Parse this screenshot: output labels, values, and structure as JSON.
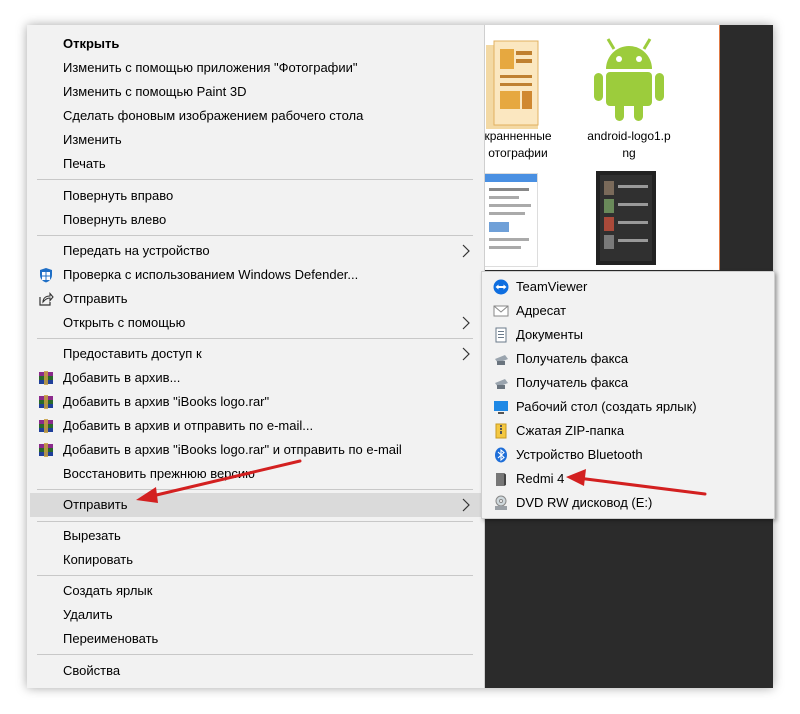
{
  "explorer": {
    "thumbs": [
      {
        "label_line1": "кранненные",
        "label_line2": "отографии",
        "icon": "photos-folder-thumbnail"
      },
      {
        "label_line1": "android-logo1.p",
        "label_line2": "ng",
        "icon": "android-logo-thumbnail"
      }
    ]
  },
  "context_menu": {
    "items": [
      {
        "label": "Открыть",
        "bold": true
      },
      {
        "label": "Изменить с помощью приложения \"Фотографии\""
      },
      {
        "label": "Изменить с помощью Paint 3D"
      },
      {
        "label": "Сделать фоновым изображением рабочего стола"
      },
      {
        "label": "Изменить"
      },
      {
        "label": "Печать"
      },
      {
        "label": "Повернуть вправо"
      },
      {
        "label": "Повернуть влево"
      },
      {
        "label": "Передать на устройство"
      },
      {
        "label": "Проверка с использованием Windows Defender..."
      },
      {
        "label": "Отправить"
      },
      {
        "label": "Открыть с помощью"
      },
      {
        "label": "Предоставить доступ к"
      },
      {
        "label": "Добавить в архив..."
      },
      {
        "label": "Добавить в архив \"iBooks logo.rar\""
      },
      {
        "label": "Добавить в архив и отправить по e-mail..."
      },
      {
        "label": "Добавить в архив \"iBooks logo.rar\" и отправить по e-mail"
      },
      {
        "label": "Восстановить прежнюю версию"
      },
      {
        "label": "Отправить"
      },
      {
        "label": "Вырезать"
      },
      {
        "label": "Копировать"
      },
      {
        "label": "Создать ярлык"
      },
      {
        "label": "Удалить"
      },
      {
        "label": "Переименовать"
      },
      {
        "label": "Свойства"
      }
    ]
  },
  "send_to_menu": {
    "items": [
      {
        "label": "TeamViewer",
        "icon": "teamviewer-icon"
      },
      {
        "label": "Адресат",
        "icon": "mail-recipient-icon"
      },
      {
        "label": "Документы",
        "icon": "documents-icon"
      },
      {
        "label": "Получатель факса",
        "icon": "fax-icon"
      },
      {
        "label": "Получатель факса",
        "icon": "fax-icon"
      },
      {
        "label": "Рабочий стол (создать ярлык)",
        "icon": "desktop-icon"
      },
      {
        "label": "Сжатая ZIP-папка",
        "icon": "zip-folder-icon"
      },
      {
        "label": "Устройство Bluetooth",
        "icon": "bluetooth-icon"
      },
      {
        "label": "Redmi 4",
        "icon": "phone-device-icon"
      },
      {
        "label": "DVD RW дисковод (E:)",
        "icon": "dvd-drive-icon"
      }
    ]
  },
  "colors": {
    "menu_bg": "#f2f2f2",
    "highlight": "#dadada",
    "annotation_arrow": "#d32020"
  }
}
